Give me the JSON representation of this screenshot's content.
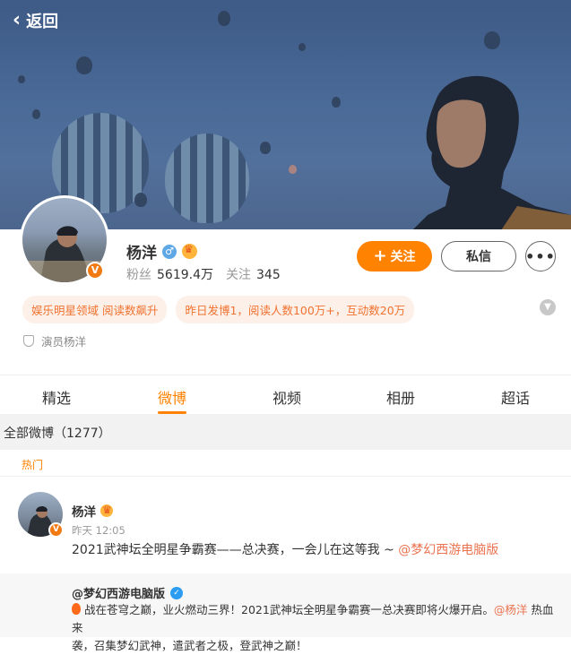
{
  "header": {
    "back_label": "返回"
  },
  "profile": {
    "name": "杨洋",
    "fans_label": "粉丝",
    "fans_value": "5619.4万",
    "following_label": "关注",
    "following_value": "345",
    "verified_badge": "V",
    "verification": "演员杨洋",
    "tags": [
      "娱乐明星领域 阅读数飙升",
      "昨日发博1，阅读人数100万+，互动数20万"
    ]
  },
  "actions": {
    "follow_label": "关注",
    "follow_plus": "+",
    "message_label": "私信",
    "more_label": "•••"
  },
  "tabs": [
    {
      "label": "精选",
      "active": false
    },
    {
      "label": "微博",
      "active": true
    },
    {
      "label": "视频",
      "active": false
    },
    {
      "label": "相册",
      "active": false
    },
    {
      "label": "超话",
      "active": false
    }
  ],
  "feed": {
    "section_title": "全部微博（1277）",
    "hot_label": "热门",
    "post": {
      "author": "杨洋",
      "time": "昨天 12:05",
      "text": "2021武神坛全明星争霸赛——总决赛，一会儿在这等我 ~ ",
      "mention": "@梦幻西游电脑版",
      "repost": {
        "author": "@梦幻西游电脑版",
        "text_line1_a": "战在苍穹之巅，业火燃动三界！2021武神坛全明星争霸赛一总决赛即将火爆开启。",
        "text_line1_mention": "@杨洋",
        "text_line1_b": " 热血来",
        "text_line2": "袭，召集梦幻武神，遣武者之极，登武神之巅！"
      }
    }
  },
  "colors": {
    "accent": "#ff8200",
    "link": "#eb7350",
    "tag_bg": "#fdf0e8",
    "tag_text": "#f07230"
  },
  "icons": [
    "back-chevron-icon",
    "male-icon",
    "crown-icon",
    "verified-badge-icon",
    "shield-icon",
    "chevron-down-icon",
    "fire-icon"
  ]
}
